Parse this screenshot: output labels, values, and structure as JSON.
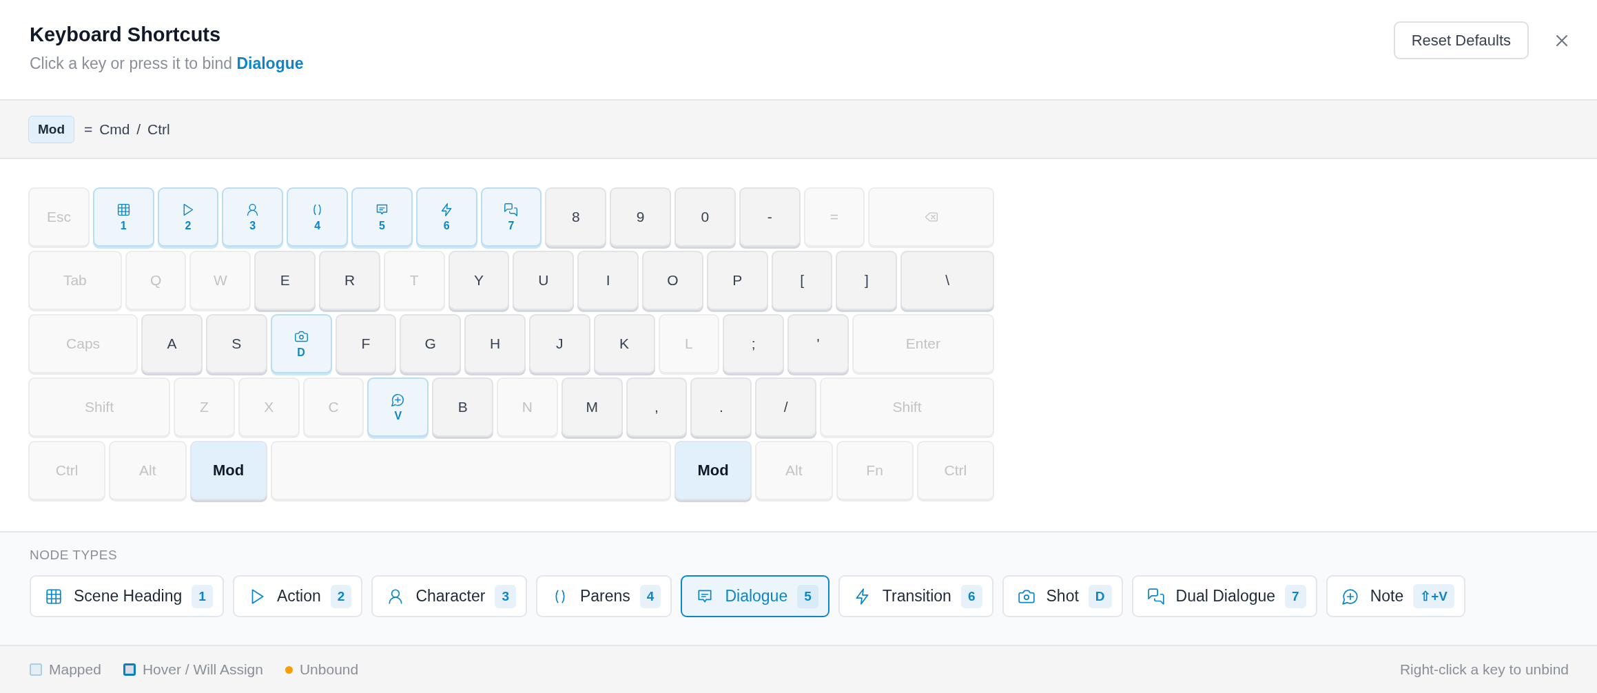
{
  "header": {
    "title": "Keyboard Shortcuts",
    "subtitle": "Click a key or press it to bind **Dialogue**",
    "reset_button": "Reset Defaults"
  },
  "mod_bar": {
    "badge": "Mod",
    "meaning": "= Cmd / Ctrl"
  },
  "keyboard": {
    "rows": [
      {
        "keys": [
          {
            "label": "Esc",
            "kind": "unbound"
          },
          {
            "label": "1",
            "kind": "scene"
          },
          {
            "label": "2",
            "kind": "action"
          },
          {
            "label": "3",
            "kind": "character"
          },
          {
            "label": "4",
            "kind": "parens"
          },
          {
            "label": "5",
            "kind": "dialogue"
          },
          {
            "label": "6",
            "kind": "transition"
          },
          {
            "label": "7",
            "kind": "dual"
          },
          {
            "label": "8",
            "kind": "bound"
          },
          {
            "label": "9",
            "kind": "bound"
          },
          {
            "label": "0",
            "kind": "bound"
          },
          {
            "label": "-",
            "kind": "bound"
          },
          {
            "label": "=",
            "kind": "unbound"
          },
          {
            "kind": "backspace"
          }
        ]
      },
      {
        "keys": [
          {
            "label": "Tab",
            "kind": "unbound"
          },
          {
            "label": "Q",
            "kind": "unbound"
          },
          {
            "label": "W",
            "kind": "unbound"
          },
          {
            "label": "E",
            "kind": "bound"
          },
          {
            "label": "R",
            "kind": "bound"
          },
          {
            "label": "T",
            "kind": "unbound"
          },
          {
            "label": "Y",
            "kind": "bound"
          },
          {
            "label": "U",
            "kind": "bound"
          },
          {
            "label": "I",
            "kind": "bound"
          },
          {
            "label": "O",
            "kind": "bound"
          },
          {
            "label": "P",
            "kind": "bound"
          },
          {
            "label": "[",
            "kind": "bound"
          },
          {
            "label": "]",
            "kind": "bound"
          },
          {
            "label": "\\",
            "kind": "bound"
          }
        ]
      },
      {
        "keys": [
          {
            "label": "Caps",
            "kind": "unbound"
          },
          {
            "label": "A",
            "kind": "bound"
          },
          {
            "label": "S",
            "kind": "bound"
          },
          {
            "label": "D",
            "kind": "shot"
          },
          {
            "label": "F",
            "kind": "bound"
          },
          {
            "label": "G",
            "kind": "bound"
          },
          {
            "label": "H",
            "kind": "bound"
          },
          {
            "label": "J",
            "kind": "bound"
          },
          {
            "label": "K",
            "kind": "bound"
          },
          {
            "label": "L",
            "kind": "unbound"
          },
          {
            "label": ";",
            "kind": "bound"
          },
          {
            "label": "'",
            "kind": "bound"
          },
          {
            "label": "Enter",
            "kind": "unbound"
          }
        ]
      },
      {
        "keys": [
          {
            "label": "Shift",
            "kind": "unbound"
          },
          {
            "label": "Z",
            "kind": "unbound"
          },
          {
            "label": "X",
            "kind": "unbound"
          },
          {
            "label": "C",
            "kind": "unbound"
          },
          {
            "label": "V",
            "kind": "note"
          },
          {
            "label": "B",
            "kind": "bound"
          },
          {
            "label": "N",
            "kind": "unbound"
          },
          {
            "label": "M",
            "kind": "bound"
          },
          {
            "label": ",",
            "kind": "bound"
          },
          {
            "label": ".",
            "kind": "bound"
          },
          {
            "label": "/",
            "kind": "bound"
          },
          {
            "label": "Shift",
            "kind": "unbound"
          }
        ]
      },
      {
        "keys": [
          {
            "label": "Ctrl",
            "kind": "unbound"
          },
          {
            "label": "Alt",
            "kind": "unbound"
          },
          {
            "label": "Mod",
            "kind": "mod"
          },
          {
            "kind": "space"
          },
          {
            "label": "Mod",
            "kind": "mod"
          },
          {
            "label": "Alt",
            "kind": "unbound"
          },
          {
            "label": "Fn",
            "kind": "unbound"
          },
          {
            "label": "Ctrl",
            "kind": "unbound"
          }
        ]
      }
    ]
  },
  "node_types": {
    "heading": "NODE TYPES",
    "items": [
      {
        "kind": "scene",
        "label": "Scene Heading",
        "shortcut": "1",
        "selected": false
      },
      {
        "kind": "action",
        "label": "Action",
        "shortcut": "2",
        "selected": false
      },
      {
        "kind": "character",
        "label": "Character",
        "shortcut": "3",
        "selected": false
      },
      {
        "kind": "parens",
        "label": "Parens",
        "shortcut": "4",
        "selected": false
      },
      {
        "kind": "dialogue",
        "label": "Dialogue",
        "shortcut": "5",
        "selected": true
      },
      {
        "kind": "transition",
        "label": "Transition",
        "shortcut": "6",
        "selected": false
      },
      {
        "kind": "shot",
        "label": "Shot",
        "shortcut": "D",
        "selected": false
      },
      {
        "kind": "dual",
        "label": "Dual Dialogue",
        "shortcut": "7",
        "selected": false
      },
      {
        "kind": "note",
        "label": "Note",
        "shortcut": "⇧+V",
        "selected": false
      }
    ]
  },
  "footer": {
    "legend": [
      {
        "kind": "mapped",
        "label": "Mapped"
      },
      {
        "kind": "hover",
        "label": "Hover / Will Assign"
      },
      {
        "kind": "unbound",
        "label": "Unbound"
      }
    ],
    "hint": "Right-click a key to unbind"
  }
}
